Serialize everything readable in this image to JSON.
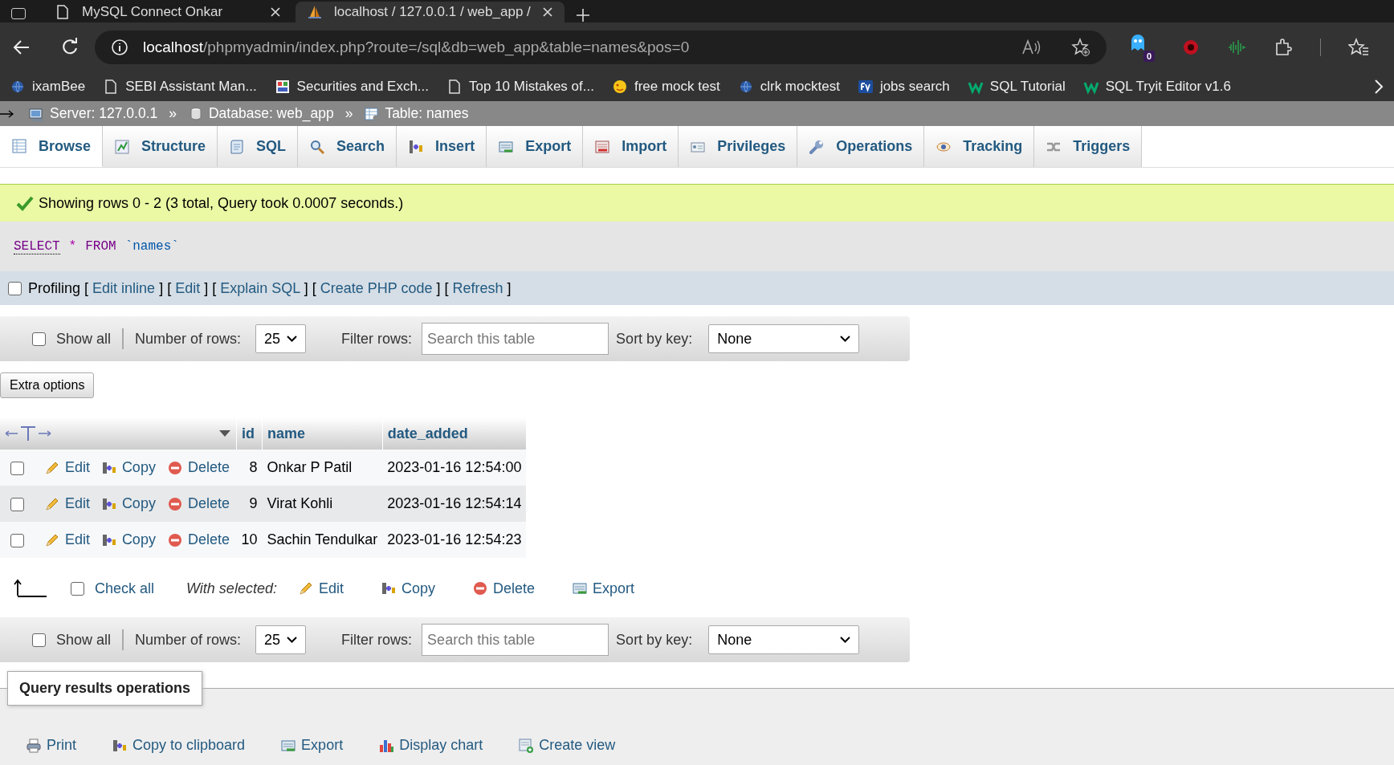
{
  "browser": {
    "tabs": [
      {
        "title": "MySQL Connect Onkar",
        "selected": false,
        "kind": "page"
      },
      {
        "title": "localhost / 127.0.0.1 / web_app /",
        "selected": true,
        "kind": "pma"
      }
    ],
    "address": {
      "host": "localhost",
      "path": "/phpmyadmin/index.php?route=/sql&db=web_app&table=names&pos=0"
    },
    "extension_badge": "0",
    "bookmarks": [
      {
        "label": "ixamBee",
        "kind": "globe"
      },
      {
        "label": "SEBI Assistant Man...",
        "kind": "page"
      },
      {
        "label": "Securities and Exch...",
        "kind": "image"
      },
      {
        "label": "Top 10 Mistakes of...",
        "kind": "page"
      },
      {
        "label": "free mock test",
        "kind": "sa"
      },
      {
        "label": "clrk mocktest",
        "kind": "globe"
      },
      {
        "label": "jobs search",
        "kind": "fv"
      },
      {
        "label": "SQL Tutorial",
        "kind": "w"
      },
      {
        "label": "SQL Tryit Editor v1.6",
        "kind": "w"
      }
    ]
  },
  "breadcrumb": [
    {
      "label": "Server: 127.0.0.1",
      "kind": "server"
    },
    {
      "label": "Database: web_app",
      "kind": "db"
    },
    {
      "label": "Table: names",
      "kind": "table"
    }
  ],
  "breadcrumb_separator": "»",
  "tabs": [
    {
      "label": "Browse",
      "kind": "browse",
      "selected": true
    },
    {
      "label": "Structure",
      "kind": "structure",
      "selected": false
    },
    {
      "label": "SQL",
      "kind": "sql",
      "selected": false
    },
    {
      "label": "Search",
      "kind": "search",
      "selected": false
    },
    {
      "label": "Insert",
      "kind": "insert",
      "selected": false
    },
    {
      "label": "Export",
      "kind": "export",
      "selected": false
    },
    {
      "label": "Import",
      "kind": "import",
      "selected": false
    },
    {
      "label": "Privileges",
      "kind": "privileges",
      "selected": false
    },
    {
      "label": "Operations",
      "kind": "operations",
      "selected": false
    },
    {
      "label": "Tracking",
      "kind": "tracking",
      "selected": false
    },
    {
      "label": "Triggers",
      "kind": "triggers",
      "selected": false
    }
  ],
  "message": "Showing rows 0 - 2 (3 total, Query took 0.0007 seconds.)",
  "sql": [
    {
      "text": "SELECT",
      "kind": "keyword"
    },
    {
      "text": "*",
      "kind": "operator"
    },
    {
      "text": "FROM",
      "kind": "keyword"
    },
    {
      "text": "`names`",
      "kind": "identifier"
    }
  ],
  "profiling": {
    "checked": false,
    "parts": [
      {
        "kind": "text",
        "text": "Profiling ["
      },
      {
        "kind": "link",
        "text": "Edit inline"
      },
      {
        "kind": "text",
        "text": "] ["
      },
      {
        "kind": "link",
        "text": "Edit"
      },
      {
        "kind": "text",
        "text": "] ["
      },
      {
        "kind": "link",
        "text": "Explain SQL"
      },
      {
        "kind": "text",
        "text": "] ["
      },
      {
        "kind": "link",
        "text": "Create PHP code"
      },
      {
        "kind": "text",
        "text": "] ["
      },
      {
        "kind": "link",
        "text": "Refresh"
      },
      {
        "kind": "text",
        "text": "]"
      }
    ]
  },
  "navigation": [
    {
      "show_all": {
        "label": "Show all",
        "checked": false
      },
      "rows_label": "Number of rows:",
      "rows_value": "25",
      "filter_label": "Filter rows:",
      "filter_placeholder": "Search this table",
      "sort_label": "Sort by key:",
      "sort_value": "None"
    },
    {
      "show_all": {
        "label": "Show all",
        "checked": false
      },
      "rows_label": "Number of rows:",
      "rows_value": "25",
      "filter_label": "Filter rows:",
      "filter_placeholder": "Search this table",
      "sort_label": "Sort by key:",
      "sort_value": "None"
    }
  ],
  "extra_options": "Extra options",
  "table": {
    "columns": [
      "id",
      "name",
      "date_added"
    ],
    "rows": [
      {
        "checked": false,
        "actions": [
          {
            "label": "Edit",
            "kind": "edit"
          },
          {
            "label": "Copy",
            "kind": "copy"
          },
          {
            "label": "Delete",
            "kind": "delete"
          }
        ],
        "cells": [
          "8",
          "Onkar P Patil",
          "2023-01-16 12:54:00"
        ]
      },
      {
        "checked": false,
        "actions": [
          {
            "label": "Edit",
            "kind": "edit"
          },
          {
            "label": "Copy",
            "kind": "copy"
          },
          {
            "label": "Delete",
            "kind": "delete"
          }
        ],
        "cells": [
          "9",
          "Virat Kohli",
          "2023-01-16 12:54:14"
        ]
      },
      {
        "checked": false,
        "actions": [
          {
            "label": "Edit",
            "kind": "edit"
          },
          {
            "label": "Copy",
            "kind": "copy"
          },
          {
            "label": "Delete",
            "kind": "delete"
          }
        ],
        "cells": [
          "10",
          "Sachin Tendulkar",
          "2023-01-16 12:54:23"
        ]
      }
    ]
  },
  "bulk": {
    "check_all": {
      "label": "Check all",
      "checked": false
    },
    "with_selected": "With selected:",
    "actions": [
      {
        "label": "Edit",
        "kind": "edit"
      },
      {
        "label": "Copy",
        "kind": "copy"
      },
      {
        "label": "Delete",
        "kind": "delete"
      },
      {
        "label": "Export",
        "kind": "export"
      }
    ]
  },
  "operations": {
    "legend": "Query results operations",
    "items": [
      {
        "label": "Print",
        "kind": "print"
      },
      {
        "label": "Copy to clipboard",
        "kind": "copy"
      },
      {
        "label": "Export",
        "kind": "export"
      },
      {
        "label": "Display chart",
        "kind": "chart"
      },
      {
        "label": "Create view",
        "kind": "view"
      }
    ]
  }
}
